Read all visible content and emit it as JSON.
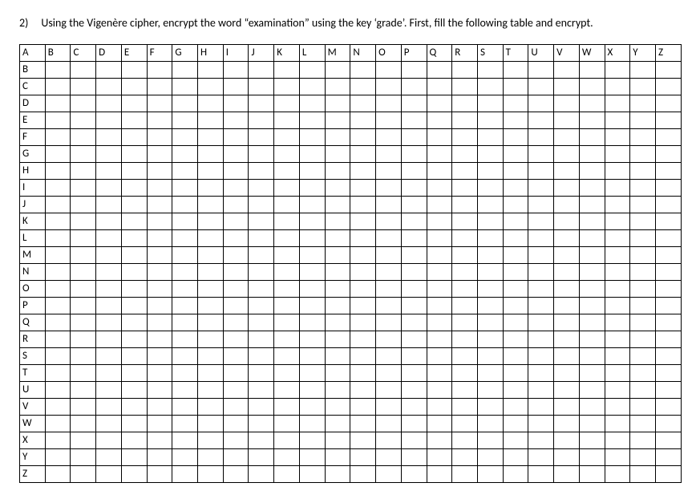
{
  "question": {
    "number": "2)",
    "text": "Using the Vigenère cipher, encrypt the word “examination” using the key ‘grade’.   First, fill the following table and encrypt."
  },
  "alphabet": [
    "A",
    "B",
    "C",
    "D",
    "E",
    "F",
    "G",
    "H",
    "I",
    "J",
    "K",
    "L",
    "M",
    "N",
    "O",
    "P",
    "Q",
    "R",
    "S",
    "T",
    "U",
    "V",
    "W",
    "X",
    "Y",
    "Z"
  ]
}
